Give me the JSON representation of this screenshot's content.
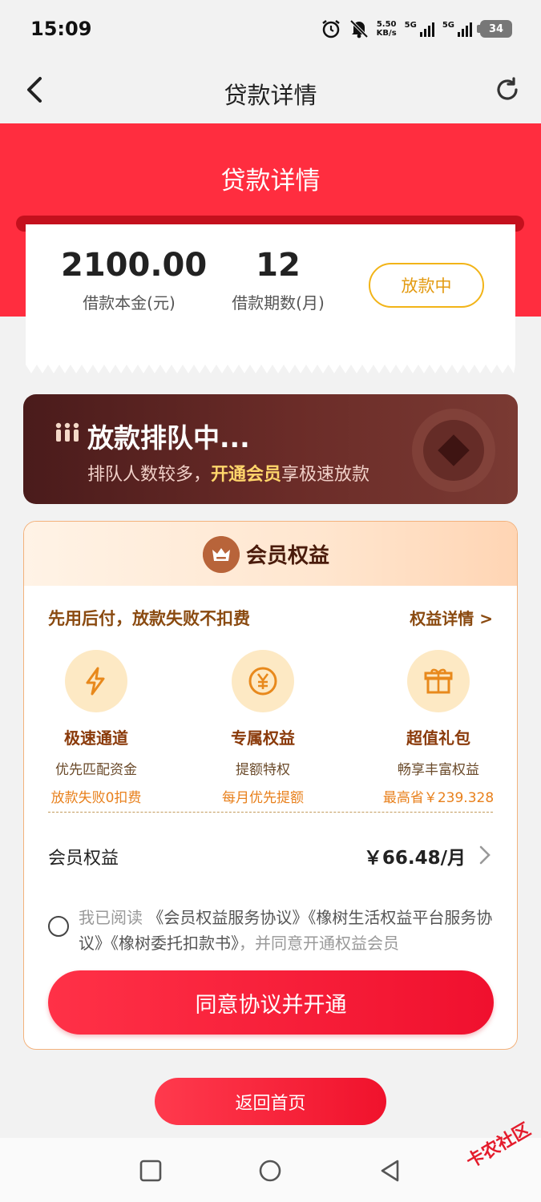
{
  "status_bar": {
    "time": "15:09",
    "net_speed_value": "5.50",
    "net_speed_unit": "KB/s",
    "sim1_label": "5G",
    "sim2_label": "5G",
    "battery": "34"
  },
  "nav": {
    "title": "贷款详情"
  },
  "header": {
    "title": "贷款详情",
    "color": "#ff2d3f"
  },
  "loan": {
    "principal_value": "2100.00",
    "principal_label": "借款本金(元)",
    "term_value": "12",
    "term_label": "借款期数(月)",
    "status": "放款中"
  },
  "queue_banner": {
    "title": "放款排队中...",
    "subtitle_prefix": "排队人数较多，",
    "subtitle_highlight": "开通会员",
    "subtitle_suffix": "享极速放款"
  },
  "membership": {
    "header_title": "会员权益",
    "promo": "先用后付，放款失败不扣费",
    "detail_link": "权益详情 >",
    "benefits": [
      {
        "icon": "lightning-icon",
        "title": "极速通道",
        "sub1": "优先匹配资金",
        "sub2": "放款失败0扣费"
      },
      {
        "icon": "yen-coin-icon",
        "title": "专属权益",
        "sub1": "提额特权",
        "sub2": "每月优先提额"
      },
      {
        "icon": "gift-icon",
        "title": "超值礼包",
        "sub1": "畅享丰富权益",
        "sub2": "最高省￥239.328"
      }
    ],
    "fee_label": "会员权益",
    "fee_value": "￥66.48/月",
    "agreement_prefix": "我已阅读 ",
    "agreement_docs": "《会员权益服务协议》《橡树生活权益平台服务协议》《橡树委托扣款书》",
    "agreement_suffix": "，并同意开通权益会员",
    "open_button": "同意协议并开通"
  },
  "home_button": "返回首页",
  "watermark": "卡农社区"
}
